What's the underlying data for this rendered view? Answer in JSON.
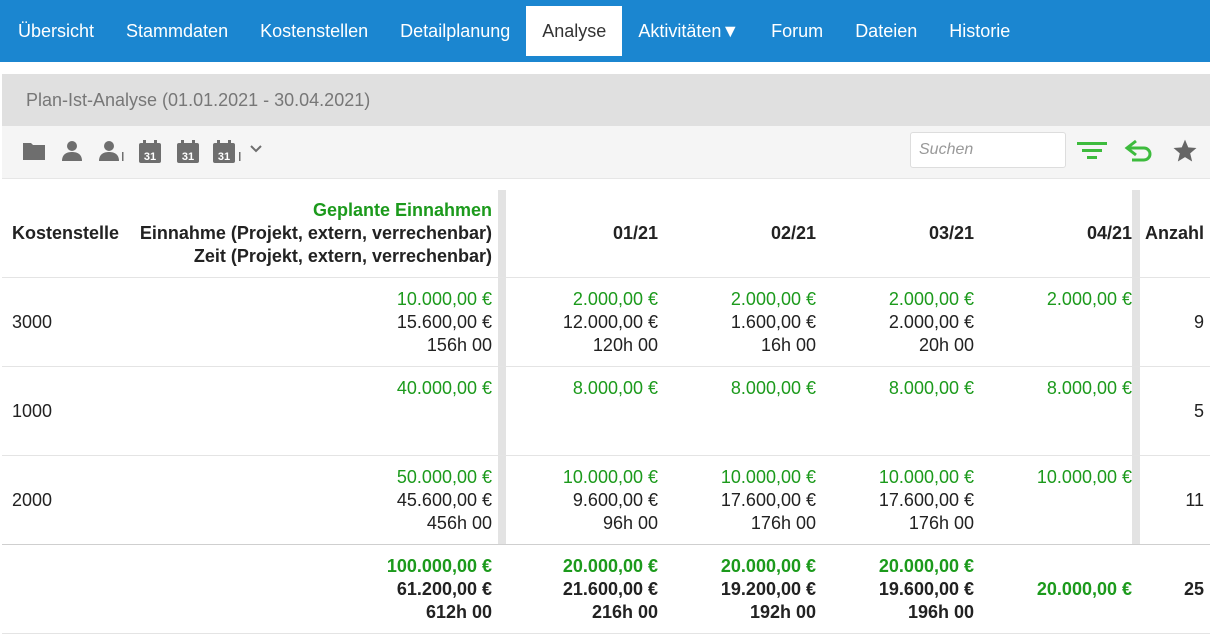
{
  "nav": {
    "tabs": [
      {
        "label": "Übersicht",
        "active": false
      },
      {
        "label": "Stammdaten",
        "active": false
      },
      {
        "label": "Kostenstellen",
        "active": false
      },
      {
        "label": "Detailplanung",
        "active": false
      },
      {
        "label": "Analyse",
        "active": true
      },
      {
        "label": "Aktivitäten▼",
        "active": false
      },
      {
        "label": "Forum",
        "active": false
      },
      {
        "label": "Dateien",
        "active": false
      },
      {
        "label": "Historie",
        "active": false
      }
    ]
  },
  "page": {
    "title": "Plan-Ist-Analyse (01.01.2021 - 30.04.2021)"
  },
  "toolbar": {
    "icons": [
      "folder-icon",
      "user-icon",
      "users-icon",
      "calendar-icon",
      "calendar-icon",
      "calendar-icon",
      "chevron-down-icon"
    ],
    "calendar_day": "31",
    "search_placeholder": "Suchen",
    "right_icons": [
      "filter-icon",
      "undo-icon",
      "star-icon"
    ]
  },
  "colors": {
    "nav": "#1b86d0",
    "green": "#1c9a1c",
    "title_bar": "#e0e0e0"
  },
  "table": {
    "headers": {
      "kostenstelle": "Kostenstelle",
      "plan_line1": "Geplante Einnahmen",
      "plan_line2": "Einnahme (Projekt, extern, verrechenbar)",
      "plan_line3": "Zeit (Projekt, extern, verrechenbar)",
      "months": [
        "01/21",
        "02/21",
        "03/21",
        "04/21"
      ],
      "anzahl": "Anzahl"
    },
    "rows": [
      {
        "kostenstelle": "3000",
        "plan": [
          "10.000,00 €",
          "15.600,00 €",
          "156h 00"
        ],
        "months": [
          [
            "2.000,00 €",
            "12.000,00 €",
            "120h 00"
          ],
          [
            "2.000,00 €",
            "1.600,00 €",
            "16h 00"
          ],
          [
            "2.000,00 €",
            "2.000,00 €",
            "20h 00"
          ],
          [
            "2.000,00 €",
            "",
            ""
          ]
        ],
        "anzahl": "9"
      },
      {
        "kostenstelle": "1000",
        "plan": [
          "40.000,00 €",
          "",
          ""
        ],
        "months": [
          [
            "8.000,00 €",
            "",
            ""
          ],
          [
            "8.000,00 €",
            "",
            ""
          ],
          [
            "8.000,00 €",
            "",
            ""
          ],
          [
            "8.000,00 €",
            "",
            ""
          ]
        ],
        "anzahl": "5"
      },
      {
        "kostenstelle": "2000",
        "plan": [
          "50.000,00 €",
          "45.600,00 €",
          "456h 00"
        ],
        "months": [
          [
            "10.000,00 €",
            "9.600,00 €",
            "96h 00"
          ],
          [
            "10.000,00 €",
            "17.600,00 €",
            "176h 00"
          ],
          [
            "10.000,00 €",
            "17.600,00 €",
            "176h 00"
          ],
          [
            "10.000,00 €",
            "",
            ""
          ]
        ],
        "anzahl": "11"
      }
    ],
    "total": {
      "plan": [
        "100.000,00 €",
        "61.200,00 €",
        "612h 00"
      ],
      "months": [
        [
          "20.000,00 €",
          "21.600,00 €",
          "216h 00"
        ],
        [
          "20.000,00 €",
          "19.200,00 €",
          "192h 00"
        ],
        [
          "20.000,00 €",
          "19.600,00 €",
          "196h 00"
        ],
        [
          "20.000,00 €"
        ]
      ],
      "anzahl": "25"
    }
  }
}
